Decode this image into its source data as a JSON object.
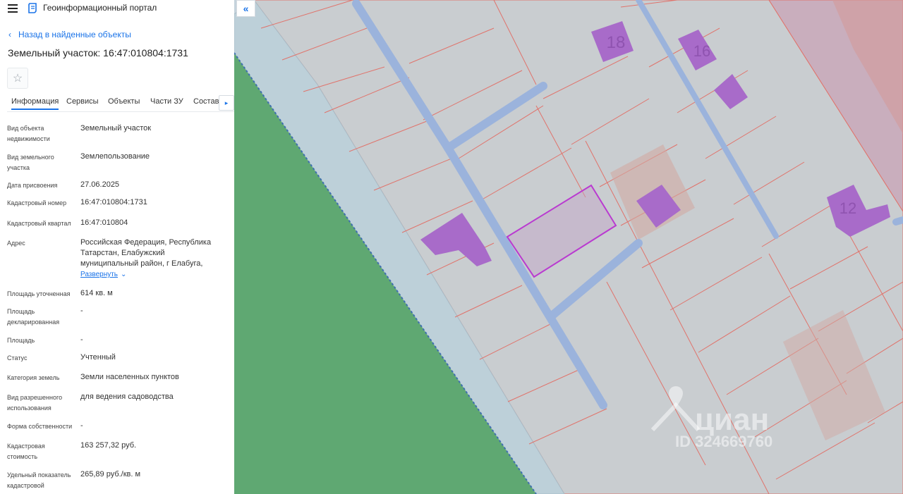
{
  "header": {
    "app_title": "Геоинформационный портал",
    "menu_icon": "menu-icon",
    "logo_icon": "portal-logo-icon"
  },
  "back_link": {
    "label": "Назад в найденные объекты"
  },
  "object": {
    "title": "Земельный участок: 16:47:010804:1731",
    "favorite_icon": "star-icon"
  },
  "tabs": [
    {
      "label": "Информация",
      "active": true
    },
    {
      "label": "Сервисы"
    },
    {
      "label": "Объекты"
    },
    {
      "label": "Части ЗУ"
    },
    {
      "label": "Состав"
    }
  ],
  "info": {
    "type_label": "Вид объекта недвижимости",
    "type_value": "Земельный участок",
    "land_type_label": "Вид земельного участка",
    "land_type_value": "Землепользование",
    "date_label": "Дата присвоения",
    "date_value": "27.06.2025",
    "cad_num_label": "Кадастровый номер",
    "cad_num_value": "16:47:010804:1731",
    "cad_quarter_label": "Кадастровый квартал",
    "cad_quarter_value": "16:47:010804",
    "address_label": "Адрес",
    "address_value": "Российская Федерация, Республика Татарстан, Елабужский муниципальный район, г Елабуга,",
    "expand_label": "Развернуть",
    "area_spec_label": "Площадь уточненная",
    "area_spec_value": "614 кв. м",
    "area_decl_label": "Площадь декларированная",
    "area_decl_value": "-",
    "area_label": "Площадь",
    "area_value": "-",
    "status_label": "Статус",
    "status_value": "Учтенный",
    "category_label": "Категория земель",
    "category_value": "Земли населенных пунктов",
    "use_label": "Вид разрешенного использования",
    "use_value": "для ведения садоводства",
    "ownership_label": "Форма собственности",
    "ownership_value": "-",
    "cad_cost_label": "Кадастровая стоимость",
    "cad_cost_value": "163 257,32 руб.",
    "specific_label": "Удельный показатель кадастровой",
    "specific_value": "265,89 руб./кв. м"
  },
  "map": {
    "collapse_icon": "double-chevron-left-icon",
    "house_numbers": [
      "18",
      "16",
      "12"
    ],
    "watermark_brand": "циан",
    "watermark_id": "ID 324669760",
    "colors": {
      "forest": "#5fa872",
      "parcel": "#c9cdd0",
      "parcel_border": "#e0736b",
      "road": "#9bb3dc",
      "building": "#a86bc9",
      "selected": "#b93ad0"
    }
  }
}
